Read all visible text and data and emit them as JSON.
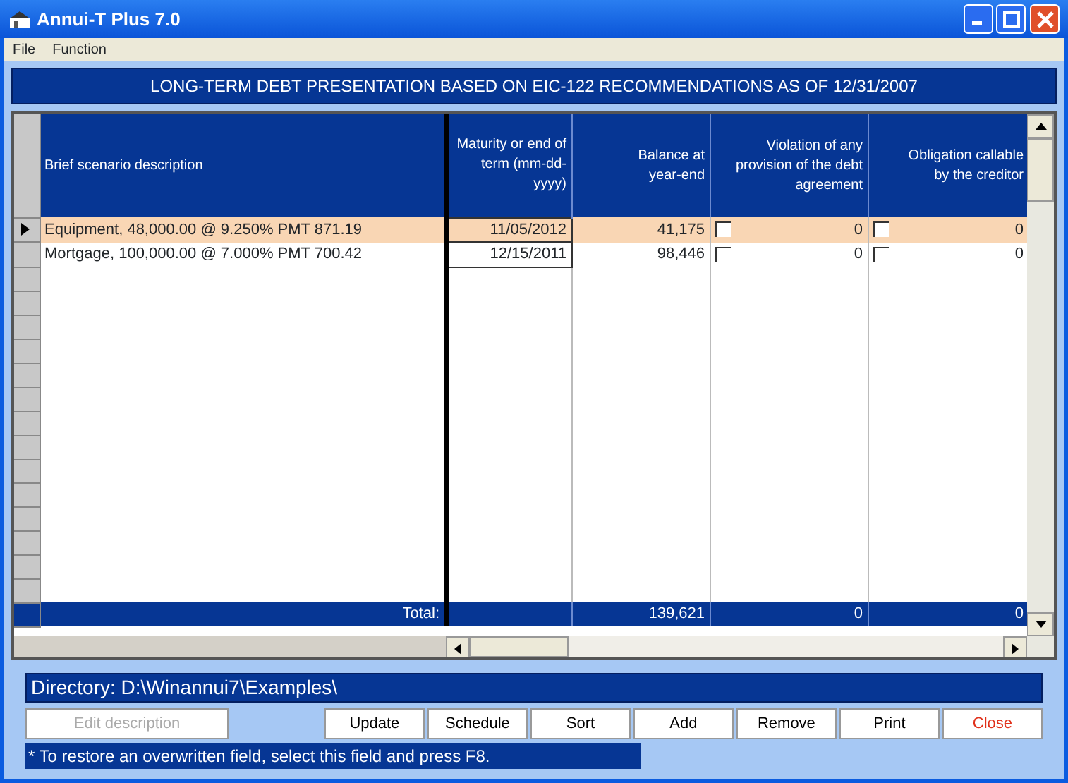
{
  "window": {
    "title": "Annui-T Plus 7.0"
  },
  "menu": [
    "File",
    "Function"
  ],
  "banner": "LONG-TERM DEBT PRESENTATION BASED ON EIC-122 RECOMMENDATIONS AS OF 12/31/2007",
  "table": {
    "columns": [
      "Brief scenario description",
      "Maturity or end of term (mm-dd-yyyy)",
      "Balance at year-end",
      "Violation of any provision of the debt agreement",
      "Obligation callable by the creditor"
    ],
    "rows": [
      {
        "selected": true,
        "description": "Equipment, 48,000.00 @ 9.250% PMT 871.19",
        "maturity": "11/05/2012",
        "balance": "41,175",
        "violation_checked": false,
        "violation": "0",
        "obligation_checked": false,
        "obligation": "0"
      },
      {
        "selected": false,
        "description": "Mortgage, 100,000.00 @ 7.000% PMT 700.42",
        "maturity": "12/15/2011",
        "balance": "98,446",
        "violation_checked": false,
        "violation": "0",
        "obligation_checked": false,
        "obligation": "0"
      }
    ],
    "total": {
      "label": "Total:",
      "balance": "139,621",
      "violation": "0",
      "obligation": "0"
    }
  },
  "directory": "Directory: D:\\Winannui7\\Examples\\",
  "buttons": [
    {
      "label": "Edit description",
      "disabled": true,
      "kind": "normal"
    },
    {
      "label": "Update",
      "disabled": false,
      "kind": "normal"
    },
    {
      "label": "Schedule",
      "disabled": false,
      "kind": "normal"
    },
    {
      "label": "Sort",
      "disabled": false,
      "kind": "normal"
    },
    {
      "label": "Add",
      "disabled": false,
      "kind": "normal"
    },
    {
      "label": "Remove",
      "disabled": false,
      "kind": "normal"
    },
    {
      "label": "Print",
      "disabled": false,
      "kind": "normal"
    },
    {
      "label": "Close",
      "disabled": false,
      "kind": "close"
    }
  ],
  "note": "* To restore an overwritten field, select this field and press F8."
}
